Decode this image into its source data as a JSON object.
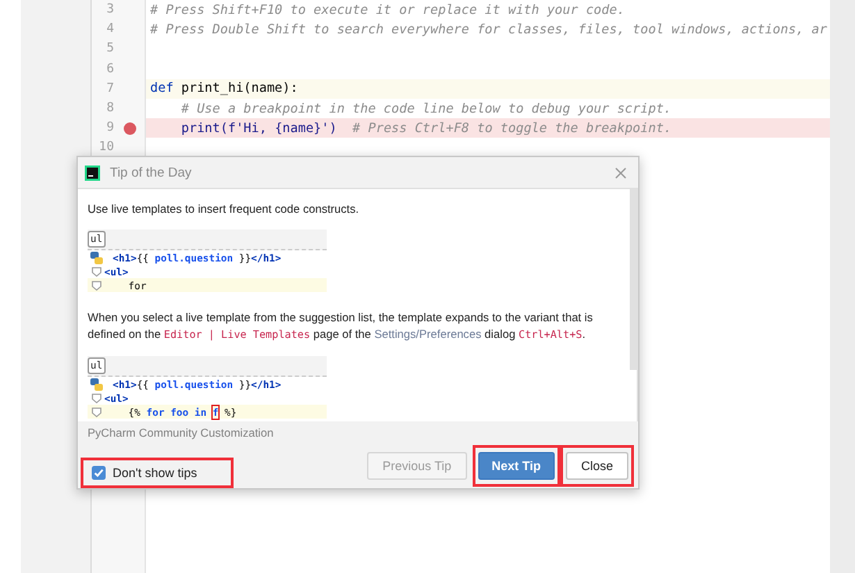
{
  "editor": {
    "lines": [
      {
        "number": "3",
        "current": false,
        "breakpoint": false,
        "tokens": [
          {
            "text": "# Press Shift+F10 to execute it or replace it with your code.",
            "kind": "comment"
          }
        ]
      },
      {
        "number": "4",
        "current": false,
        "breakpoint": false,
        "tokens": [
          {
            "text": "# Press Double Shift to search everywhere for classes, files, tool windows, actions, ar",
            "kind": "comment"
          }
        ]
      },
      {
        "number": "5",
        "current": false,
        "breakpoint": false
      },
      {
        "number": "6",
        "current": false,
        "breakpoint": false
      },
      {
        "number": "7",
        "current": true,
        "breakpoint": false,
        "tokens": [
          {
            "text": "def",
            "kind": "keyword"
          },
          {
            "text": " print_hi(name):",
            "kind": "plain"
          }
        ]
      },
      {
        "number": "8",
        "current": false,
        "breakpoint": false,
        "tokens": [
          {
            "text": "    # Use a breakpoint in the code line below to debug your script.",
            "kind": "comment"
          }
        ]
      },
      {
        "number": "9",
        "current": false,
        "breakpoint": true,
        "tokens": [
          {
            "text": "    print",
            "kind": "builtin"
          },
          {
            "text": "(f'Hi, ",
            "kind": "string"
          },
          {
            "text": "{name}",
            "kind": "builtin"
          },
          {
            "text": "')",
            "kind": "string"
          },
          {
            "text": "  # Press Ctrl+F8 to toggle the breakpoint.",
            "kind": "comment"
          }
        ]
      },
      {
        "number": "10",
        "current": false,
        "breakpoint": false
      }
    ]
  },
  "dialog": {
    "title": "Tip of the Day",
    "tip": [
      {
        "kind": "text",
        "segments": [
          {
            "text": "Use live templates to insert frequent code constructs.",
            "kind": "text"
          }
        ]
      },
      {
        "kind": "snippet",
        "abbrev": "ul",
        "lines": [
          {
            "current": false,
            "tokens": [
              {
                "text": "<h1>",
                "kind": "tag"
              },
              {
                "text": "{{ ",
                "kind": "plain"
              },
              {
                "text": "poll.question",
                "kind": "var"
              },
              {
                "text": " }}",
                "kind": "plain"
              },
              {
                "text": "</h1>",
                "kind": "tag"
              }
            ]
          },
          {
            "current": false,
            "tokens": [
              {
                "text": "<ul>",
                "kind": "tag"
              }
            ]
          },
          {
            "current": true,
            "tokens": [
              {
                "text": "    for",
                "kind": "plain"
              }
            ]
          }
        ]
      },
      {
        "kind": "text",
        "segments": [
          {
            "text": "When you select a live template from the suggestion list, the template expands to the variant that is defined on the ",
            "kind": "text"
          },
          {
            "text": "Editor | Live Templates",
            "kind": "code"
          },
          {
            "text": " page of the ",
            "kind": "text"
          },
          {
            "text": "Settings/Preferences",
            "kind": "path"
          },
          {
            "text": " dialog ",
            "kind": "text"
          },
          {
            "text": "Ctrl+Alt+S",
            "kind": "code"
          },
          {
            "text": ".",
            "kind": "text"
          }
        ]
      },
      {
        "kind": "snippet",
        "abbrev": "ul",
        "lines": [
          {
            "current": false,
            "tokens": [
              {
                "text": "<h1>",
                "kind": "tag"
              },
              {
                "text": "{{ ",
                "kind": "plain"
              },
              {
                "text": "poll.question",
                "kind": "var"
              },
              {
                "text": " }}",
                "kind": "plain"
              },
              {
                "text": "</h1>",
                "kind": "tag"
              }
            ]
          },
          {
            "current": false,
            "tokens": [
              {
                "text": "<ul>",
                "kind": "tag"
              }
            ]
          },
          {
            "current": true,
            "tokens": [
              {
                "text": "    {% ",
                "kind": "plain"
              },
              {
                "text": "for foo in ",
                "kind": "var"
              },
              {
                "text": "f",
                "kind": "caret"
              },
              {
                "text": " %}",
                "kind": "plain"
              }
            ]
          }
        ]
      }
    ],
    "customization": "PyCharm Community Customization",
    "checkbox": {
      "label": "Don't show tips",
      "checked": true,
      "annotated": true
    },
    "buttons": [
      {
        "label": "Previous Tip",
        "kind": "secondary",
        "disabled": true,
        "annotated": false
      },
      {
        "label": "Next Tip",
        "kind": "default",
        "disabled": false,
        "annotated": true
      },
      {
        "label": "Close",
        "kind": "secondary",
        "disabled": false,
        "annotated": true
      }
    ]
  }
}
